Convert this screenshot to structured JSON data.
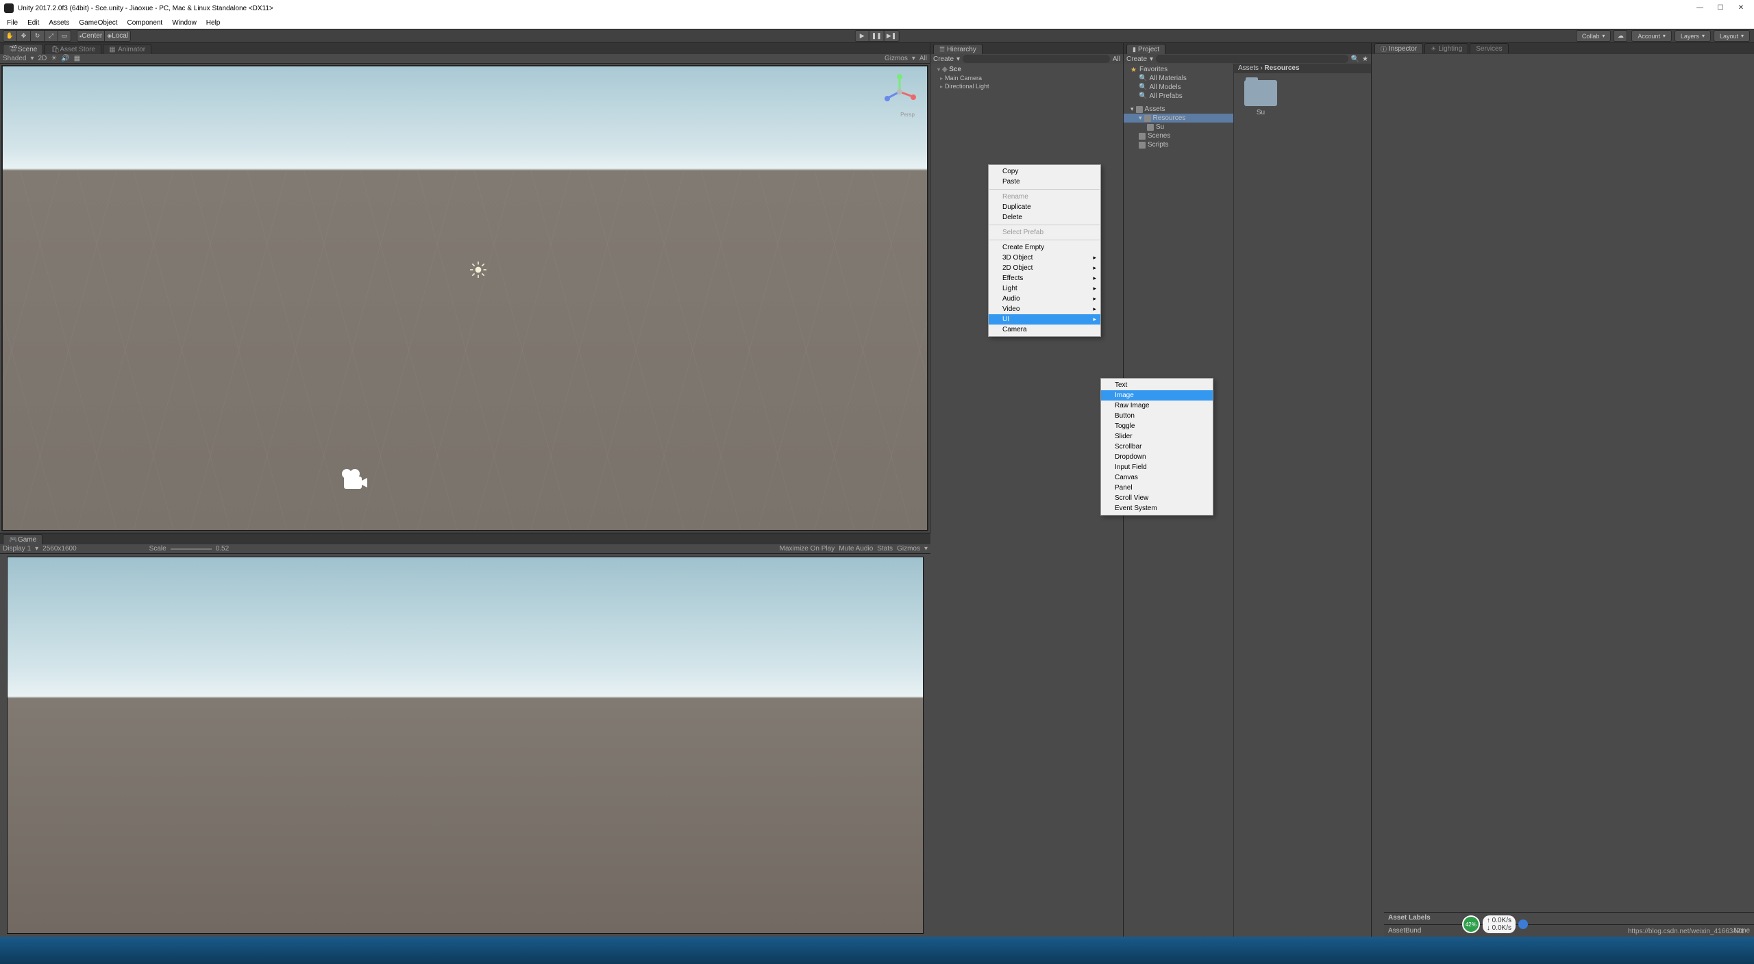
{
  "window_title": "Unity 2017.2.0f3 (64bit) - Sce.unity - Jiaoxue - PC, Mac & Linux Standalone <DX11>",
  "menus": [
    "File",
    "Edit",
    "Assets",
    "GameObject",
    "Component",
    "Window",
    "Help"
  ],
  "toolbar": {
    "pivot": "Center",
    "space": "Local",
    "collab": "Collab",
    "account": "Account",
    "layers": "Layers",
    "layout": "Layout"
  },
  "scene": {
    "tab_scene": "Scene",
    "tab_asset_store": "Asset Store",
    "tab_animator": "Animator",
    "shaded": "Shaded",
    "mode2d": "2D",
    "gizmos": "Gizmos",
    "all": "All",
    "persp": "Persp"
  },
  "game": {
    "tab": "Game",
    "display": "Display 1",
    "resolution": "2560x1600",
    "scale_label": "Scale",
    "scale_value": "0.52",
    "maximize": "Maximize On Play",
    "mute": "Mute Audio",
    "stats": "Stats",
    "gizmos": "Gizmos"
  },
  "hierarchy": {
    "title": "Hierarchy",
    "create": "Create",
    "all": "All",
    "items": [
      "Sce",
      "Main Camera",
      "Directional Light"
    ]
  },
  "project": {
    "title": "Project",
    "create": "Create",
    "favorites": "Favorites",
    "fav_materials": "All Materials",
    "fav_models": "All Models",
    "fav_prefabs": "All Prefabs",
    "assets": "Assets",
    "resources": "Resources",
    "su": "Su",
    "scenes": "Scenes",
    "scripts": "Scripts",
    "breadcrumb_assets": "Assets",
    "breadcrumb_arrow": "›",
    "breadcrumb_resources": "Resources",
    "folder_name": "Su"
  },
  "inspector": {
    "inspector": "Inspector",
    "lighting": "Lighting",
    "services": "Services"
  },
  "context_main": {
    "copy": "Copy",
    "paste": "Paste",
    "rename": "Rename",
    "duplicate": "Duplicate",
    "delete": "Delete",
    "select_prefab": "Select Prefab",
    "create_empty": "Create Empty",
    "obj3d": "3D Object",
    "obj2d": "2D Object",
    "effects": "Effects",
    "light": "Light",
    "audio": "Audio",
    "video": "Video",
    "ui": "UI",
    "camera": "Camera"
  },
  "context_ui": {
    "text": "Text",
    "image": "Image",
    "raw_image": "Raw Image",
    "button": "Button",
    "toggle": "Toggle",
    "slider": "Slider",
    "scrollbar": "Scrollbar",
    "dropdown": "Dropdown",
    "input_field": "Input Field",
    "canvas": "Canvas",
    "panel": "Panel",
    "scroll_view": "Scroll View",
    "event_system": "Event System"
  },
  "asset_labels": "Asset Labels",
  "asset_bundle": "AssetBund",
  "none": "None",
  "footer_url": "https://blog.csdn.net/weixin_41663421",
  "perf": {
    "percent": "42%",
    "speed1": "0.0K/s",
    "speed2": "0.0K/s"
  }
}
